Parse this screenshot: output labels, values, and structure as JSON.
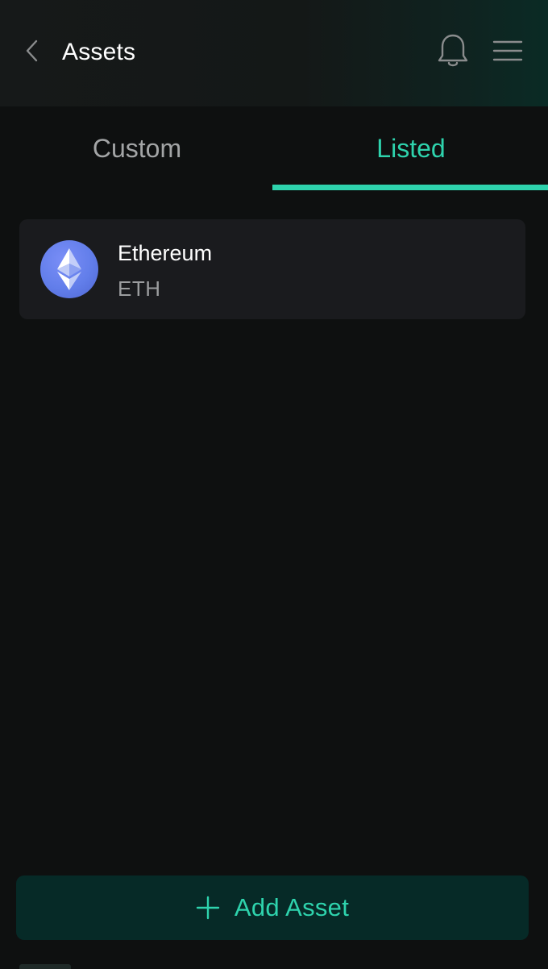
{
  "header": {
    "title": "Assets",
    "icons": {
      "back": "chevron-left-icon",
      "notifications": "bell-icon",
      "menu": "hamburger-menu-icon"
    }
  },
  "tabs": [
    {
      "label": "Custom",
      "active": false
    },
    {
      "label": "Listed",
      "active": true
    }
  ],
  "assets": [
    {
      "name": "Ethereum",
      "symbol": "ETH",
      "icon": "ethereum-logo-icon"
    }
  ],
  "actions": {
    "add_asset_label": "Add Asset",
    "add_icon": "plus-icon"
  },
  "colors": {
    "accent": "#2ed3ad",
    "background": "#0e1010",
    "card": "#1a1b1e",
    "button_bg": "#062a27",
    "eth_blue": "#627eea",
    "inactive_tab": "#a3a5a6"
  }
}
